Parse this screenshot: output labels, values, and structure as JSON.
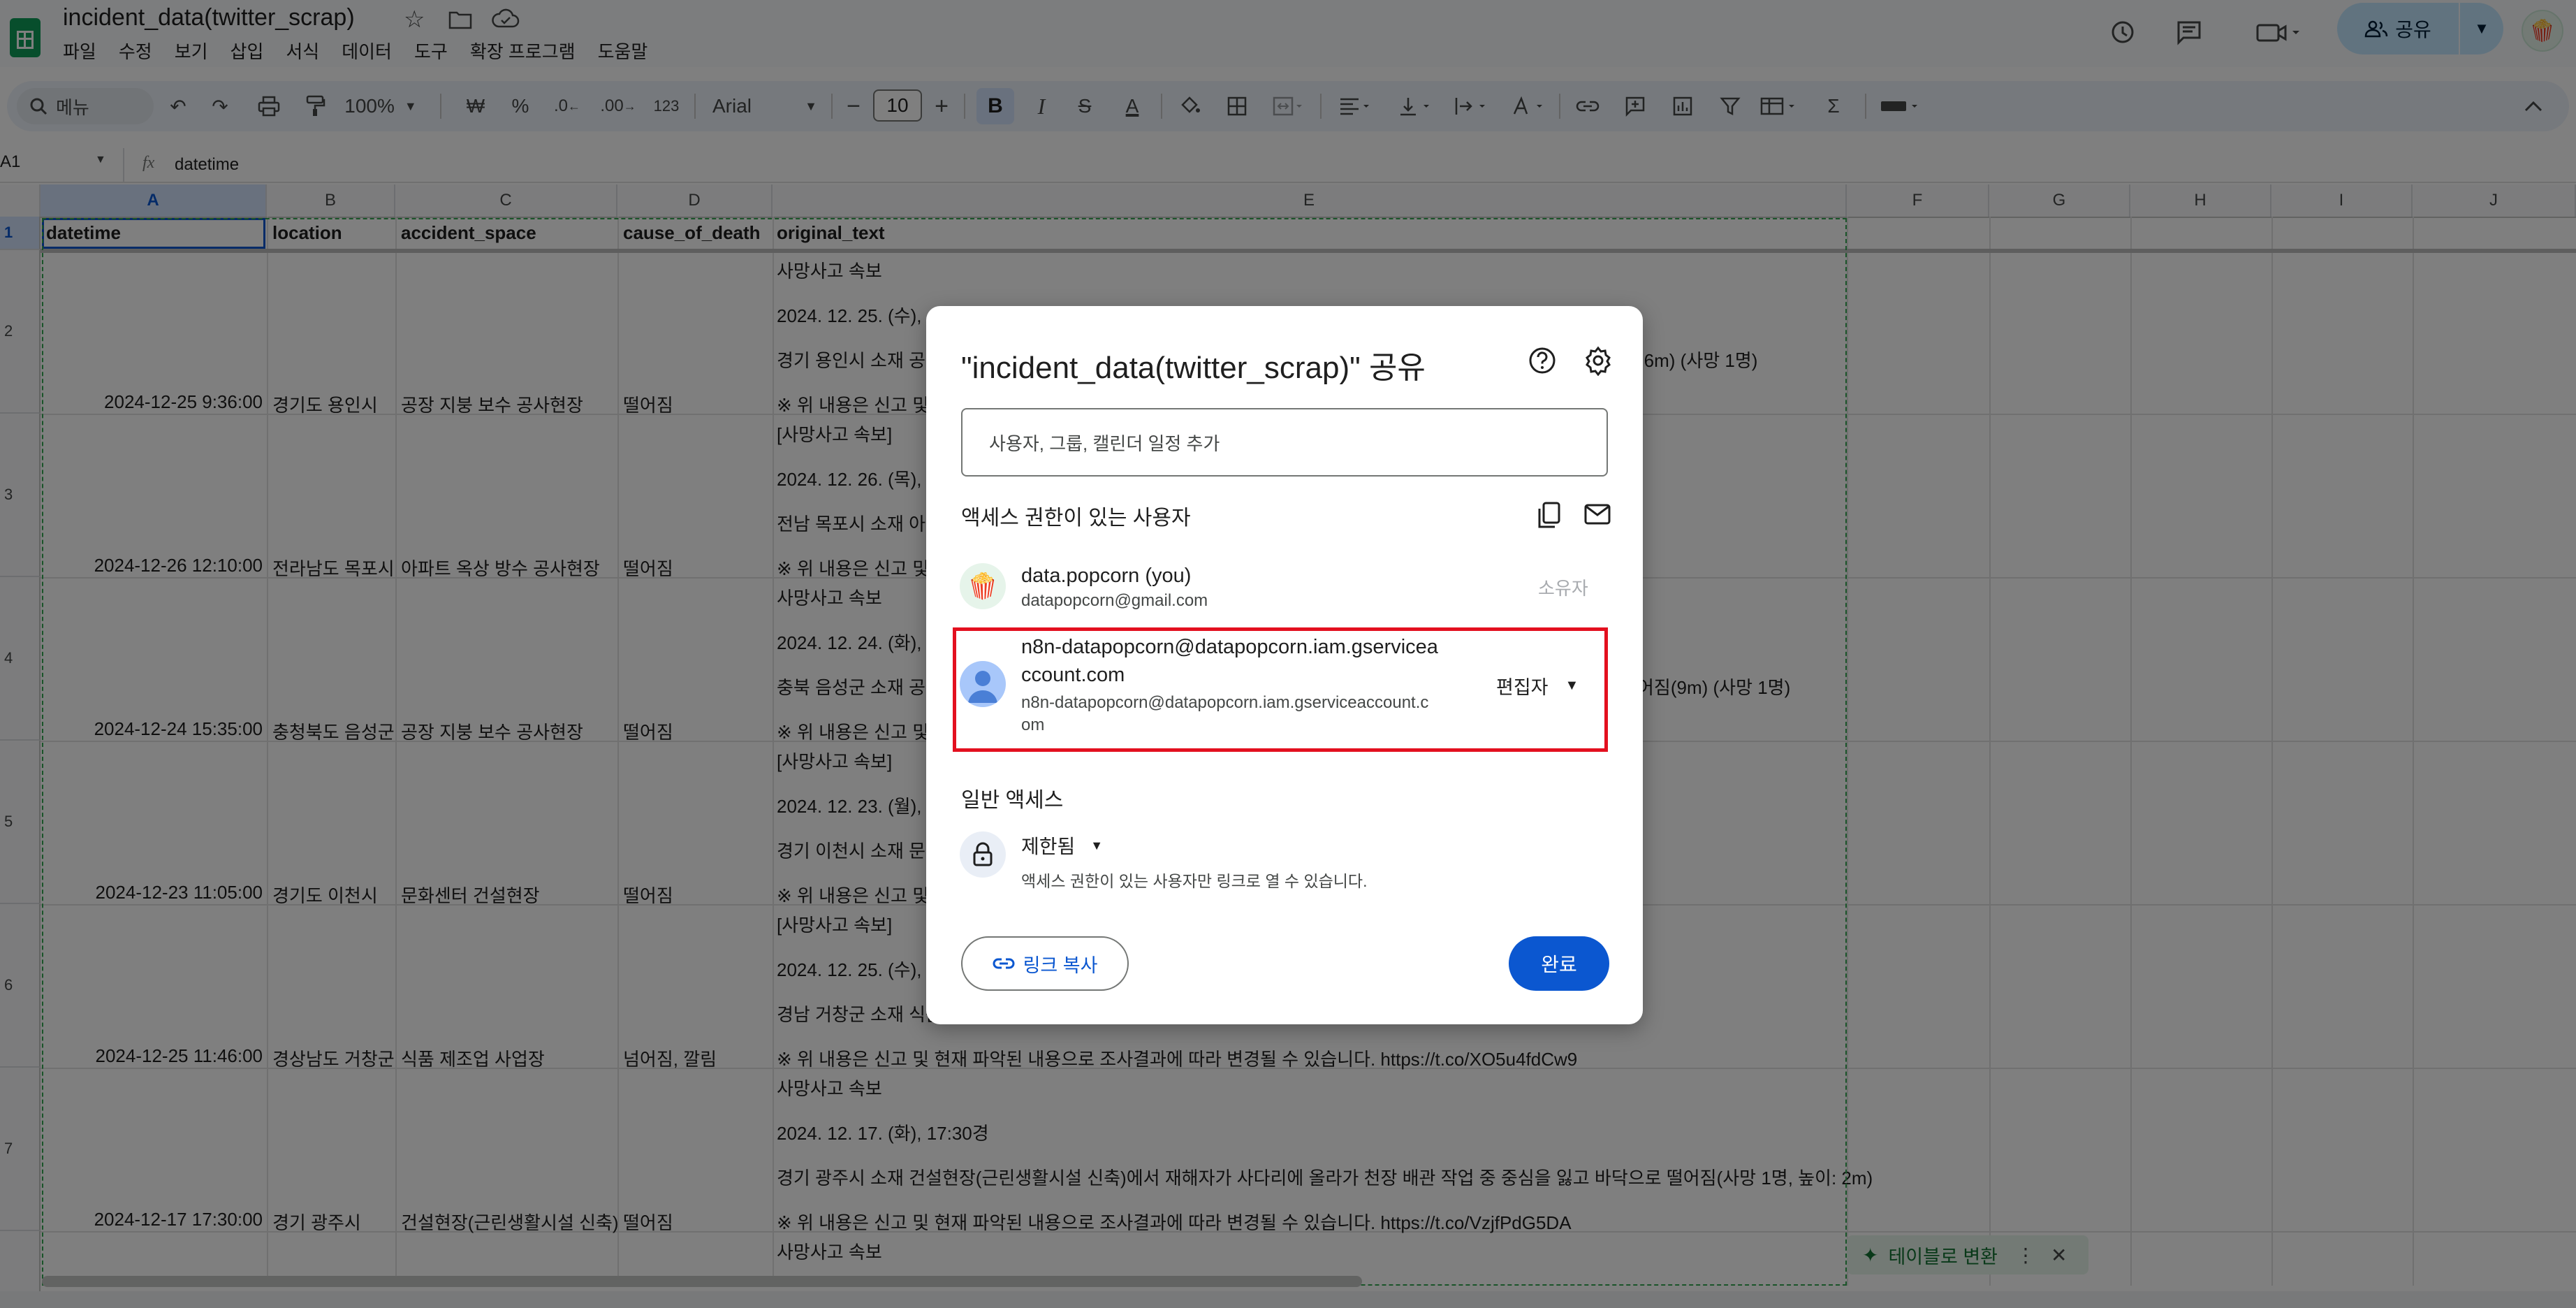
{
  "header": {
    "doc_title": "incident_data(twitter_scrap)",
    "menus": [
      "파일",
      "수정",
      "보기",
      "삽입",
      "서식",
      "데이터",
      "도구",
      "확장 프로그램",
      "도움말"
    ],
    "share_label": "공유"
  },
  "toolbar": {
    "search_label": "메뉴",
    "zoom": "100%",
    "currency": "₩",
    "percent": "%",
    "decrease_decimal": ".0",
    "increase_decimal": ".00",
    "number_format": "123",
    "font": "Arial",
    "font_size": "10",
    "bold": "B",
    "italic": "I",
    "strike": "S",
    "text_color": "A"
  },
  "formula_bar": {
    "cell_ref": "A1",
    "fx": "fx",
    "value": "datetime"
  },
  "grid": {
    "columns": [
      "A",
      "B",
      "C",
      "D",
      "E",
      "F",
      "G",
      "H",
      "I",
      "J"
    ],
    "rows": [
      "1",
      "2",
      "3",
      "4",
      "5",
      "6",
      "7"
    ],
    "header_row": [
      "datetime",
      "location",
      "accident_space",
      "cause_of_death",
      "original_text"
    ],
    "data_rows": [
      {
        "datetime": "2024-12-25 9:36:00",
        "location": "경기도 용인시",
        "space": "공장 지붕 보수 공사현장",
        "cause": "떨어짐",
        "text": [
          "사망사고 속보",
          "2024. 12. 25. (수),",
          "경기 용인시 소재 공장",
          "※ 위 내용은 신고 및"
        ],
        "overflow": "4.6m) (사망 1명)"
      },
      {
        "datetime": "2024-12-26 12:10:00",
        "location": "전라남도 목포시",
        "space": "아파트 옥상 방수 공사현장",
        "cause": "떨어짐",
        "text": [
          "[사망사고 속보]",
          "2024. 12. 26. (목),",
          "전남 목포시 소재 아",
          "※ 위 내용은 신고 및"
        ],
        "overflow": ""
      },
      {
        "datetime": "2024-12-24 15:35:00",
        "location": "충청북도 음성군",
        "space": "공장 지붕 보수 공사현장",
        "cause": "떨어짐",
        "text": [
          "사망사고 속보",
          "2024. 12. 24. (화),",
          "충북 음성군 소재 공",
          "※ 위 내용은 신고 및"
        ],
        "overflow": "어짐(9m) (사망 1명)"
      },
      {
        "datetime": "2024-12-23 11:05:00",
        "location": "경기도 이천시",
        "space": "문화센터 건설현장",
        "cause": "떨어짐",
        "text": [
          "[사망사고 속보]",
          "2024. 12. 23. (월),",
          "경기 이천시 소재 문화",
          "※ 위 내용은 신고 및"
        ],
        "overflow": ""
      },
      {
        "datetime": "2024-12-25 11:46:00",
        "location": "경상남도 거창군",
        "space": "식품 제조업 사업장",
        "cause": "넘어짐, 깔림",
        "text": [
          "[사망사고 속보]",
          "2024. 12. 25. (수),",
          "경남 거창군 소재 식품",
          "※ 위 내용은 신고 및 현재 파악된 내용으로 조사결과에 따라 변경될 수 있습니다. https://t.co/XO5u4fdCw9"
        ],
        "overflow": ""
      },
      {
        "datetime": "2024-12-17 17:30:00",
        "location": "경기 광주시",
        "space": "건설현장(근린생활시설 신축)",
        "cause": "떨어짐",
        "text": [
          "사망사고 속보",
          "2024. 12. 17. (화), 17:30경",
          "경기 광주시 소재 건설현장(근린생활시설 신축)에서 재해자가 사다리에 올라가 천장 배관 작업 중 중심을 잃고 바닥으로 떨어짐(사망 1명, 높이: 2m)",
          "※ 위 내용은 신고 및 현재 파악된 내용으로 조사결과에 따라 변경될 수 있습니다. https://t.co/VzjfPdG5DA"
        ],
        "overflow": ""
      }
    ],
    "last_visible": "사망사고 속보"
  },
  "dialog": {
    "title": "\"incident_data(twitter_scrap)\" 공유",
    "input_placeholder": "사용자, 그룹, 캘린더 일정 추가",
    "access_section": "액세스 권한이 있는 사용자",
    "users": [
      {
        "name": "data.popcorn (you)",
        "email": "datapopcorn@gmail.com",
        "role": "소유자"
      },
      {
        "name_line1": "n8n-datapopcorn@datapopcorn.iam.gservicea",
        "name_line2": "ccount.com",
        "email_line1": "n8n-datapopcorn@datapopcorn.iam.gserviceaccount.c",
        "email_line2": "om",
        "role": "편집자"
      }
    ],
    "general_access": "일반 액세스",
    "restriction": "제한됨",
    "restriction_desc": "액세스 권한이 있는 사용자만 링크로 열 수 있습니다.",
    "copy_link": "링크 복사",
    "done": "완료"
  },
  "toast": {
    "label": "테이블로 변환"
  },
  "colors": {
    "accent": "#0b57d0",
    "highlight": "#e3101f",
    "sheets_green": "#0f9d58"
  }
}
